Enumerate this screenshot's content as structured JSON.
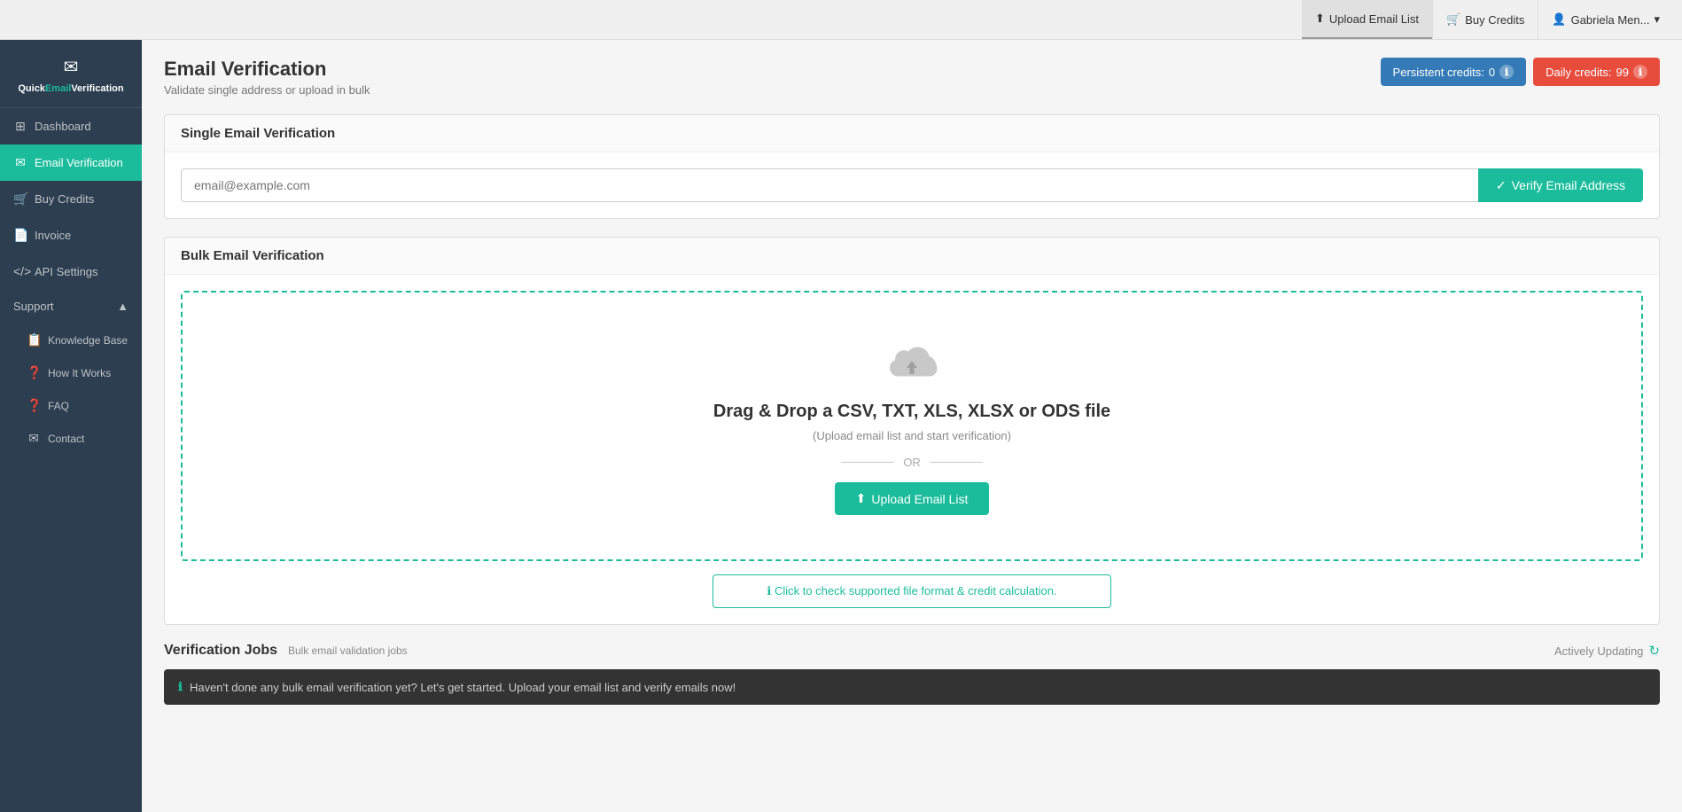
{
  "brand": {
    "icon": "✉",
    "name_quick": "Quick",
    "name_email": "Email",
    "name_ver": "Verification"
  },
  "top_nav": {
    "upload_label": "Upload Email List",
    "buy_credits_label": "Buy Credits",
    "user_label": "Gabriela Men..."
  },
  "sidebar": {
    "items": [
      {
        "id": "dashboard",
        "label": "Dashboard",
        "icon": "⊞"
      },
      {
        "id": "email-verification",
        "label": "Email Verification",
        "icon": "✉",
        "active": true
      },
      {
        "id": "buy-credits",
        "label": "Buy Credits",
        "icon": "🛒"
      },
      {
        "id": "invoice",
        "label": "Invoice",
        "icon": "📄"
      },
      {
        "id": "api-settings",
        "label": "API Settings",
        "icon": "<>"
      }
    ],
    "support_label": "Support",
    "support_items": [
      {
        "id": "knowledge-base",
        "label": "Knowledge Base",
        "icon": "📋"
      },
      {
        "id": "how-it-works",
        "label": "How It Works",
        "icon": "❓"
      },
      {
        "id": "faq",
        "label": "FAQ",
        "icon": "❓"
      },
      {
        "id": "contact",
        "label": "Contact",
        "icon": "✉"
      }
    ]
  },
  "page": {
    "title": "Email Verification",
    "subtitle": "Validate single address or upload in bulk"
  },
  "credits": {
    "persistent_label": "Persistent credits:",
    "persistent_value": "0",
    "daily_label": "Daily credits:",
    "daily_value": "99"
  },
  "single_verify": {
    "section_title": "Single Email Verification",
    "placeholder": "email@example.com",
    "button_label": "Verify Email Address",
    "button_icon": "✓"
  },
  "bulk_verify": {
    "section_title": "Bulk Email Verification",
    "drop_title": "Drag & Drop a CSV, TXT, XLS, XLSX or ODS file",
    "drop_subtitle": "(Upload email list and start verification)",
    "or_text": "OR",
    "upload_label": "Upload Email List",
    "upload_icon": "⬆",
    "info_link": "ℹ Click to check supported file format & credit calculation."
  },
  "jobs": {
    "title": "Verification Jobs",
    "subtitle": "Bulk email validation jobs",
    "actively_updating": "Actively Updating",
    "empty_message": "Haven't done any bulk email verification yet? Let's get started. Upload your email list and verify emails now!"
  }
}
